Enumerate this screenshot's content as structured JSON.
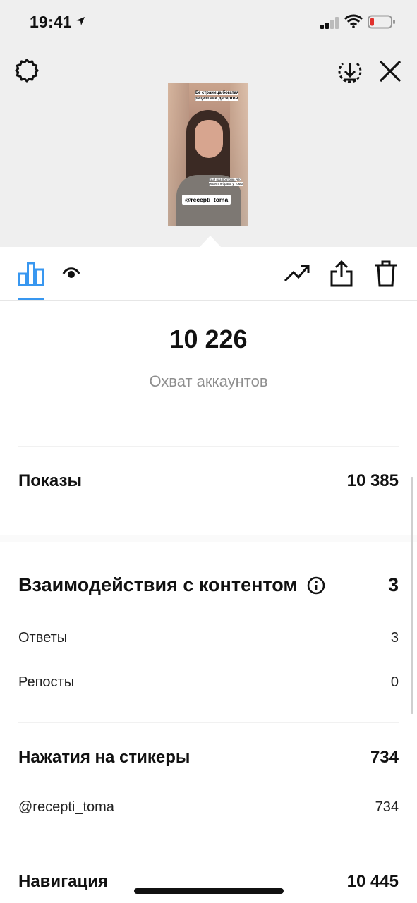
{
  "status_bar": {
    "time": "19:41"
  },
  "story_preview": {
    "caption_top": "Ее страница богатая рецептами десертов",
    "caption_bottom": "Ещё раз повторю, что рецепт я брала у Томы",
    "mention_sticker": "@recepti_toma"
  },
  "tabs": [
    {
      "name": "stats",
      "icon": "bar-chart-icon",
      "active": true
    },
    {
      "name": "viewers",
      "icon": "eye-icon",
      "active": false
    }
  ],
  "toolbar": {
    "icons": [
      "trend-icon",
      "share-icon",
      "trash-icon"
    ]
  },
  "accent_color": "#3897f0",
  "reach": {
    "value": "10 226",
    "label": "Охват аккаунтов"
  },
  "impressions": {
    "label": "Показы",
    "value": "10 385"
  },
  "interactions": {
    "label": "Взаимодействия с контентом",
    "value": "3",
    "rows": [
      {
        "label": "Ответы",
        "value": "3"
      },
      {
        "label": "Репосты",
        "value": "0"
      }
    ]
  },
  "sticker_taps": {
    "label": "Нажатия на стикеры",
    "value": "734",
    "rows": [
      {
        "label": "@recepti_toma",
        "value": "734"
      }
    ]
  },
  "navigation": {
    "label": "Навигация",
    "value": "10 445"
  }
}
